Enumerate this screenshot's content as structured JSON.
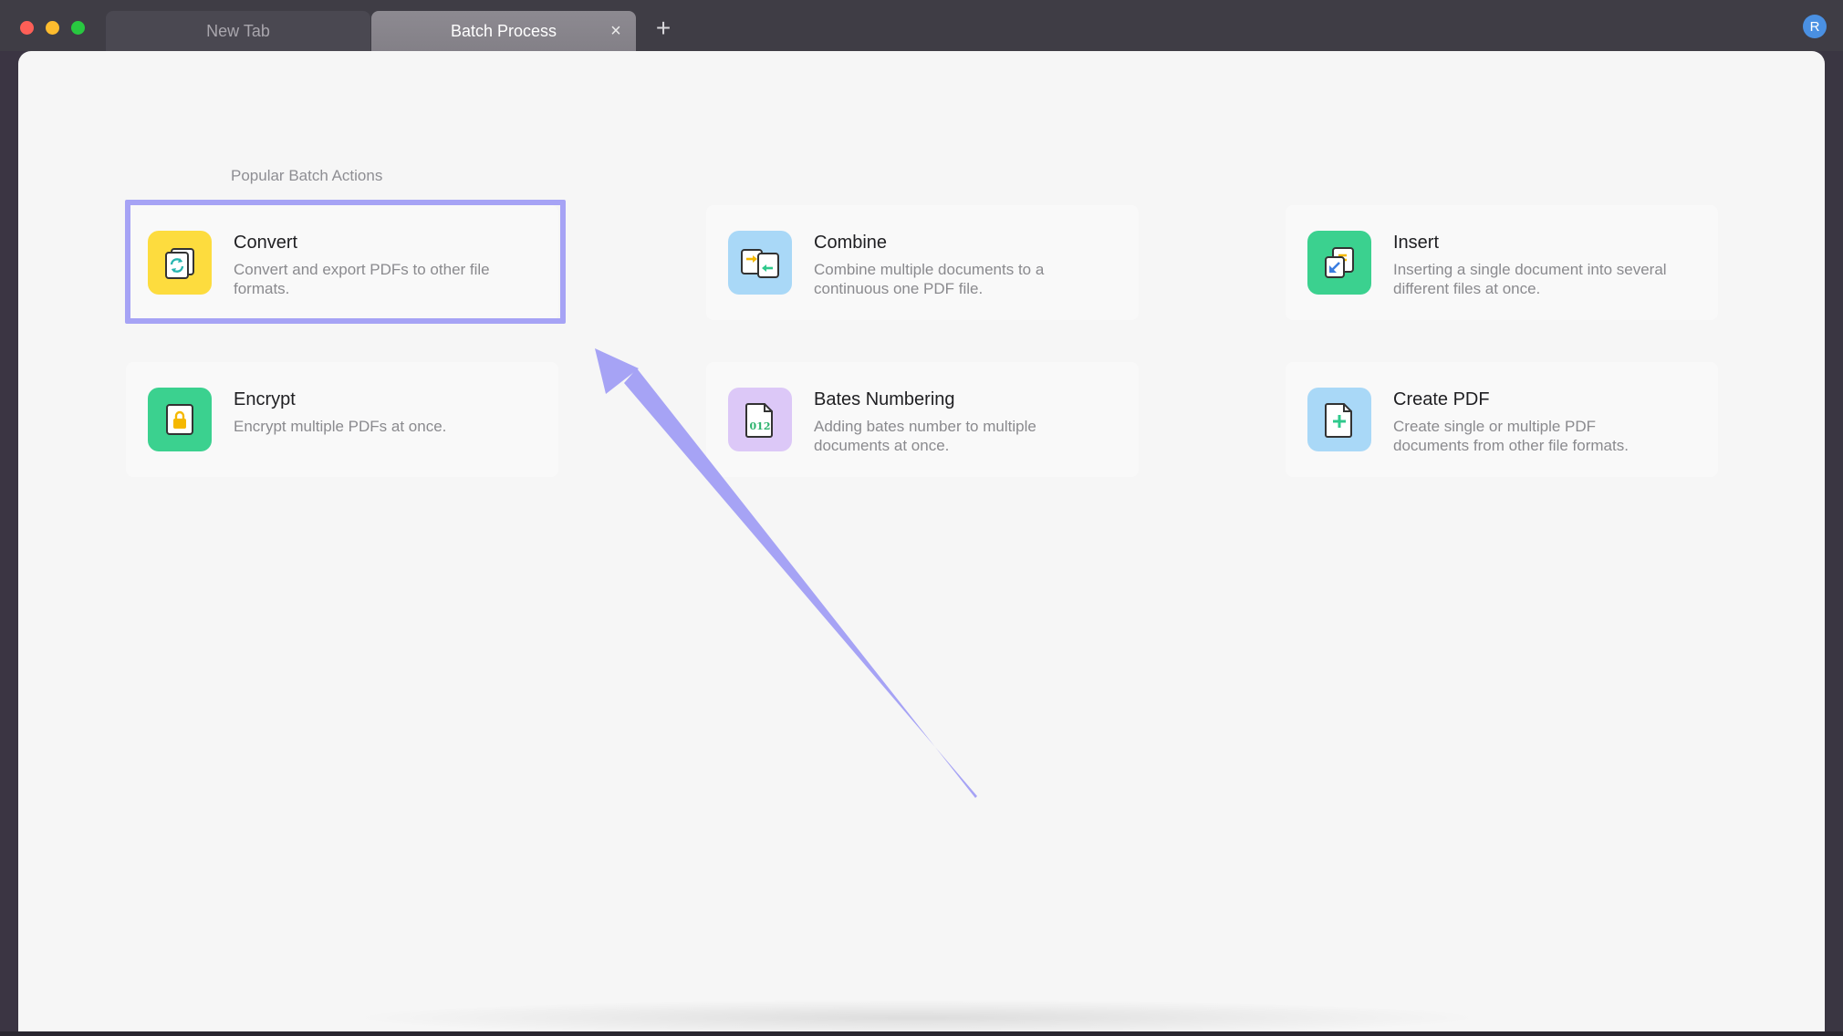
{
  "tabs": [
    {
      "label": "New Tab",
      "active": false
    },
    {
      "label": "Batch Process",
      "active": true
    }
  ],
  "tab_close_glyph": "×",
  "new_tab_glyph": "+",
  "avatar_initial": "R",
  "section_title": "Popular Batch Actions",
  "cards": [
    {
      "title": "Convert",
      "desc": "Convert and export PDFs to other file formats.",
      "icon": "convert-icon",
      "color": "#fddc3e"
    },
    {
      "title": "Combine",
      "desc": "Combine multiple documents to a continuous one PDF file.",
      "icon": "combine-icon",
      "color": "#a9d8f7"
    },
    {
      "title": "Insert",
      "desc": "Inserting a single document into several different files at once.",
      "icon": "insert-icon",
      "color": "#3bd18f"
    },
    {
      "title": "Encrypt",
      "desc": "Encrypt multiple PDFs at once.",
      "icon": "lock-icon",
      "color": "#3bd18f"
    },
    {
      "title": "Bates Numbering",
      "desc": "Adding bates number to multiple documents at once.",
      "icon": "bates-numbering-icon",
      "color": "#dcc8f7"
    },
    {
      "title": "Create PDF",
      "desc": "Create single or multiple PDF documents from other file formats.",
      "icon": "create-pdf-icon",
      "color": "#a9d8f7"
    }
  ],
  "bates_icon_text": "012",
  "annotation": {
    "highlight_color": "#a6a3f5"
  }
}
